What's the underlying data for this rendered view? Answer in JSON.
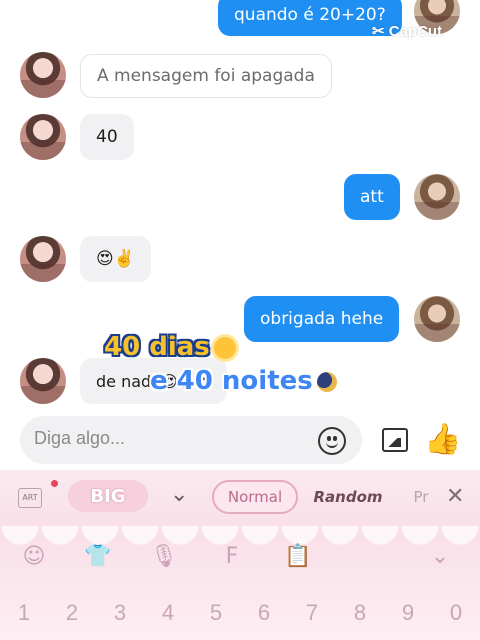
{
  "watermark": "CapCut",
  "messages": [
    {
      "side": "out",
      "text": "quando é 20+20?"
    },
    {
      "side": "in",
      "text": "A mensagem foi apagada",
      "deleted": true
    },
    {
      "side": "in",
      "text": "40"
    },
    {
      "side": "out",
      "text": "att"
    },
    {
      "side": "in",
      "text": "😍✌️"
    },
    {
      "side": "out",
      "text": "obrigada hehe"
    },
    {
      "side": "in",
      "text": "de nada😍😍😍"
    }
  ],
  "overlay": {
    "line1": "40 dias",
    "line2": "e 40 noites"
  },
  "composer": {
    "placeholder": "Diga algo..."
  },
  "keyboard": {
    "art_label": "ART",
    "big_label": "BIG",
    "style_normal": "Normal",
    "style_random": "Random",
    "style_partial": "Pr",
    "numbers": [
      "1",
      "2",
      "3",
      "4",
      "5",
      "6",
      "7",
      "8",
      "9",
      "0"
    ]
  },
  "colors": {
    "outgoing_bubble": "#1f8ff3",
    "incoming_bubble": "#f1f1f3",
    "keyboard_pink": "#f9dfe9"
  }
}
